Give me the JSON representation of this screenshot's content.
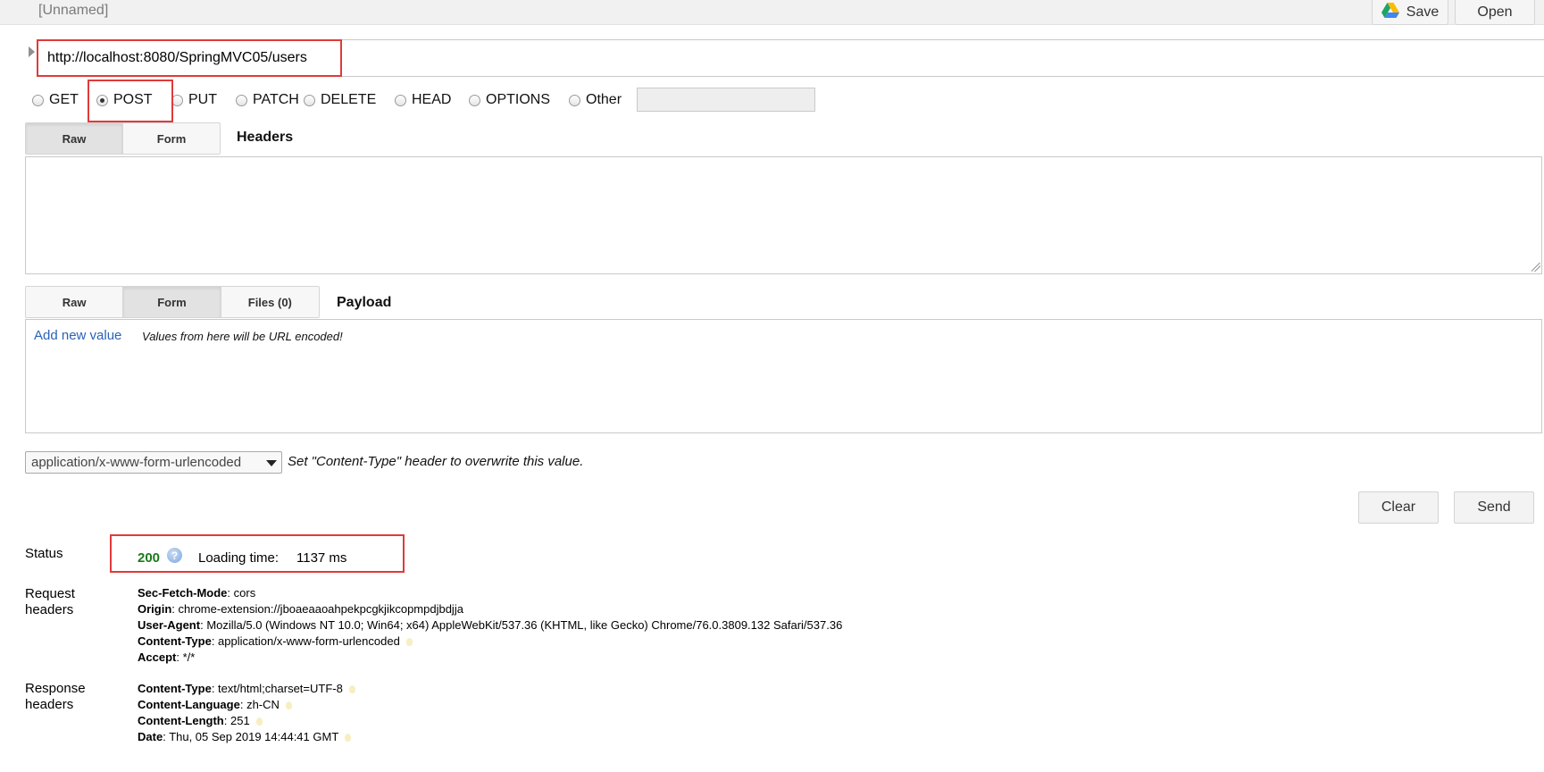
{
  "topbar": {
    "project_name": "[Unnamed]",
    "save_label": "Save",
    "open_label": "Open",
    "save_icon": "google-drive-icon"
  },
  "request": {
    "url": "http://localhost:8080/SpringMVC05/users",
    "methods": [
      "GET",
      "POST",
      "PUT",
      "PATCH",
      "DELETE",
      "HEAD",
      "OPTIONS",
      "Other"
    ],
    "selected_method": "POST",
    "other_method_value": ""
  },
  "headers_section": {
    "tabs": [
      "Raw",
      "Form"
    ],
    "active_tab": "Raw",
    "title": "Headers",
    "raw_value": ""
  },
  "payload_section": {
    "tabs": [
      "Raw",
      "Form",
      "Files (0)"
    ],
    "active_tab": "Form",
    "title": "Payload",
    "add_new_value": "Add new value",
    "encoded_note": "Values from here will be URL encoded!"
  },
  "content_type": {
    "selected": "application/x-www-form-urlencoded",
    "note": "Set \"Content-Type\" header to overwrite this value."
  },
  "actions": {
    "clear_label": "Clear",
    "send_label": "Send"
  },
  "response": {
    "status_label": "Status",
    "status_code": "200",
    "loading_label": "Loading time:",
    "loading_value": "1137 ms",
    "request_headers_label": [
      "Request",
      "headers"
    ],
    "request_headers": [
      {
        "name": "Sec-Fetch-Mode",
        "value": "cors",
        "hint": false
      },
      {
        "name": "Origin",
        "value": "chrome-extension://jboaeaaoahpekpcgkjikcopmpdjbdjja",
        "hint": false
      },
      {
        "name": "User-Agent",
        "value": "Mozilla/5.0 (Windows NT 10.0; Win64; x64) AppleWebKit/537.36 (KHTML, like Gecko) Chrome/76.0.3809.132 Safari/537.36",
        "hint": false
      },
      {
        "name": "Content-Type",
        "value": "application/x-www-form-urlencoded",
        "hint": true
      },
      {
        "name": "Accept",
        "value": "*/*",
        "hint": false
      }
    ],
    "response_headers_label": [
      "Response",
      "headers"
    ],
    "response_headers": [
      {
        "name": "Content-Type",
        "value": "text/html;charset=UTF-8",
        "hint": true
      },
      {
        "name": "Content-Language",
        "value": "zh-CN",
        "hint": true
      },
      {
        "name": "Content-Length",
        "value": "251",
        "hint": true
      },
      {
        "name": "Date",
        "value": "Thu, 05 Sep 2019 14:44:41 GMT",
        "hint": true
      }
    ]
  },
  "colors": {
    "highlight_box": "#e03a3a",
    "status_ok": "#1b7a1b",
    "link": "#2a62b8"
  }
}
